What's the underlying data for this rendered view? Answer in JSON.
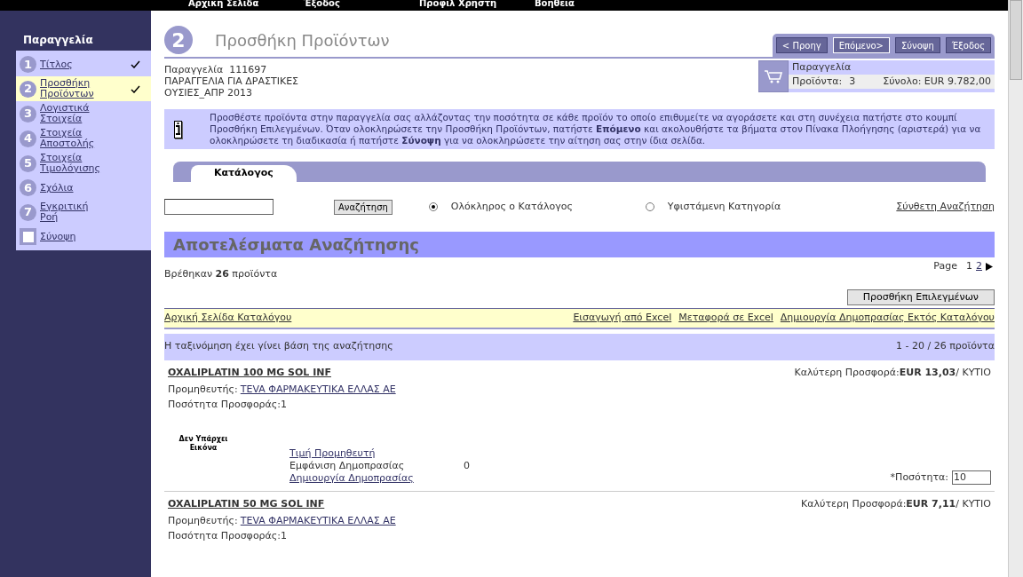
{
  "top_nav": [
    "Αρχική Σελίδα",
    "Έξοδος",
    "Προφίλ Χρήστη",
    "Βοήθεια"
  ],
  "sidebar": {
    "title": "Παραγγελία",
    "steps": [
      {
        "kind": "number",
        "number": "1",
        "label": "Τίτλος",
        "selected": false,
        "done": true
      },
      {
        "kind": "number",
        "number": "2",
        "label": "Προσθήκη Προϊόντων",
        "selected": true,
        "done": true
      },
      {
        "kind": "number",
        "number": "3",
        "label": "Λογιστικά Στοιχεία",
        "selected": false,
        "done": false
      },
      {
        "kind": "number",
        "number": "4",
        "label": "Στοιχεία Αποστολής",
        "selected": false,
        "done": false
      },
      {
        "kind": "number",
        "number": "5",
        "label": "Στοιχεία Τιμολόγισης",
        "selected": false,
        "done": false
      },
      {
        "kind": "number",
        "number": "6",
        "label": "Σχόλια",
        "selected": false,
        "done": false
      },
      {
        "kind": "number",
        "number": "7",
        "label": "Εγκριτική Ροή",
        "selected": false,
        "done": false
      },
      {
        "kind": "box",
        "label": "Σύνοψη",
        "selected": false,
        "done": false
      }
    ]
  },
  "header": {
    "step_number": "2",
    "title": "Προσθήκη Προϊόντων",
    "buttons": [
      {
        "label": "< Προηγ",
        "selected": false
      },
      {
        "label": "Επόμενο>",
        "selected": true
      },
      {
        "label": "Σύνοψη",
        "selected": false
      },
      {
        "label": "Έξοδος",
        "selected": false
      }
    ]
  },
  "order_info": [
    "Παραγγελία  111697",
    "ΠΑΡΑΓΓΕΛΙΑ ΓΙΑ ΔΡΑΣΤΙΚΕΣ",
    "ΟΥΣΙΕΣ_ΑΠΡ 2013"
  ],
  "cart": {
    "title": "Παραγγελία",
    "products_label": "Προϊόντα:",
    "products_count": "3",
    "total": "Σύνολο: EUR 9.782,00"
  },
  "info_text": "Προσθέστε προϊόντα στην παραγγελία σας αλλάζοντας την ποσότητα σε κάθε προϊόν το οποίο επιθυμείτε να αγοράσετε και στη συνέχεια πατήστε στο κουμπί Προσθήκη Επιλεγμένων. Όταν ολοκληρώσετε την Προσθήκη Προϊόντων, πατήστε **Επόμενο** και ακολουθήστε τα βήματα στον Πίνακα Πλοήγησης (αριστερά) για να ολοκληρώσετε τη διαδικασία ή πατήστε **Σύνοψη** για να ολοκληρώσετε την αίτηση σας στην ίδια σελίδα.",
  "tabs": [
    {
      "label": "Κατάλογος",
      "selected": true
    }
  ],
  "search": {
    "button": "Αναζήτηση",
    "scopes": [
      {
        "label": "Ολόκληρος ο Κατάλογος",
        "selected": true
      },
      {
        "label": "Υφιστάμενη Κατηγορία",
        "selected": false
      }
    ],
    "advanced_link": "Σύνθετη Αναζήτηση"
  },
  "results": {
    "title": "Αποτελέσματα Αναζήτησης",
    "found": "Βρέθηκαν **26** προϊόντα",
    "pager_label": "Page",
    "pages": [
      {
        "label": "1",
        "selected": true
      },
      {
        "label": "2",
        "selected": false
      }
    ],
    "add_selected": "Προσθήκη Επιλεγμένων",
    "catalog_home": "Αρχική Σελίδα Καταλόγου",
    "actions": [
      "Εισαγωγή από Excel",
      "Μεταφορά σε Excel",
      "Δημιουργία Δημοπρασίας Εκτός Καταλόγου"
    ],
    "sort_note": "Η ταξινόμηση έχει γίνει βάση της αναζήτησης",
    "range": "1 - 20 / 26 προϊόντα"
  },
  "products": [
    {
      "name": "OXALIPLATIN 100 MG SOL INF",
      "offer_label": "Καλύτερη Προσφορά:",
      "offer_price": "EUR 13,03",
      "offer_unit": "/ ΚΥΤΙΟ",
      "supplier_label": "Προμηθευτής:",
      "supplier": "TEVA ΦΑΡΜΑΚΕΥΤΙΚΑ ΕΛΛΑΣ ΑΕ",
      "offer_qty": "Ποσότητα Προσφοράς:1",
      "no_image": "Δεν Υπάρχει Εικόνα",
      "supplier_price": "Τιμή Προμηθευτή",
      "auction_show": "Εμφάνιση Δημοπρασίας",
      "auction_count": "0",
      "auction_create": "Δημιουργία Δημοπρασίας",
      "qty_label": "*Ποσότητα:",
      "qty": "10"
    },
    {
      "name": "OXALIPLATIN 50 MG SOL INF",
      "offer_label": "Καλύτερη Προσφορά:",
      "offer_price": "EUR 7,11",
      "offer_unit": "/ ΚΥΤΙΟ",
      "supplier_label": "Προμηθευτής:",
      "supplier": "TEVA ΦΑΡΜΑΚΕΥΤΙΚΑ ΕΛΛΑΣ ΑΕ",
      "offer_qty": "Ποσότητα Προσφοράς:1"
    }
  ]
}
